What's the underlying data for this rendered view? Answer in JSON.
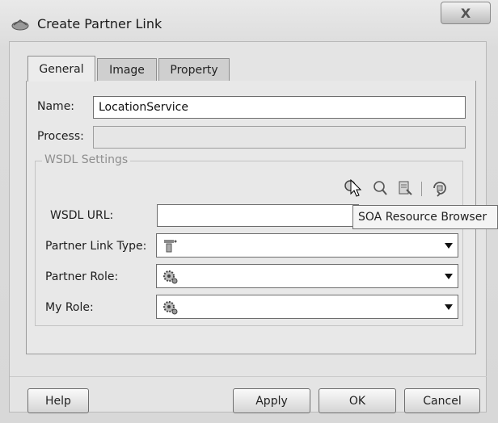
{
  "window": {
    "title": "Create Partner Link",
    "close_label": "X"
  },
  "tabs": [
    {
      "label": "General",
      "active": true
    },
    {
      "label": "Image",
      "active": false
    },
    {
      "label": "Property",
      "active": false
    }
  ],
  "form": {
    "name_label": "Name:",
    "name_value": "LocationService",
    "process_label": "Process:",
    "process_value": ""
  },
  "wsdl": {
    "group_label": "WSDL Settings",
    "url_label": "WSDL URL:",
    "url_value": "",
    "partner_link_type_label": "Partner Link Type:",
    "partner_role_label": "Partner Role:",
    "my_role_label": "My Role:",
    "toolbar_icons": [
      "soa-resource-browser-icon",
      "find-icon",
      "file-browser-icon",
      "refresh-icon"
    ],
    "tooltip": "SOA Resource Browser"
  },
  "buttons": {
    "help": "Help",
    "apply": "Apply",
    "ok": "OK",
    "cancel": "Cancel"
  }
}
